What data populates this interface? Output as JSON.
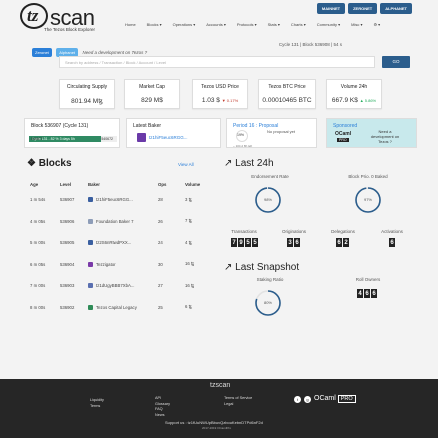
{
  "brand": {
    "logo_glyph": "tz",
    "name": "scan",
    "tagline": "The Tezos Block Explorer"
  },
  "top_buttons": [
    {
      "label": "MAINNET"
    },
    {
      "label": "ZERONET"
    },
    {
      "label": "ALPHANET"
    }
  ],
  "nav": [
    "Home",
    "Blocks ▾",
    "Operations ▾",
    "Accounts ▾",
    "Protocols ▾",
    "Stats ▾",
    "Charts ▾",
    "Community ▾",
    "Misc ▾",
    "⚙ ▾"
  ],
  "infobar": {
    "mainnet": "Zeronet",
    "alphanet": "Alphanet",
    "dev_text": "Need a development on Tezos ?",
    "cycle_text": "Cycle 131 | Block 536908 | 54 s"
  },
  "search": {
    "placeholder": "Search by address / Transaction / Block / Account / Level",
    "go": "GO"
  },
  "stats": [
    {
      "label": "Circulating Supply",
      "value": "801.94 M",
      "suffix": "ꜩ",
      "delta": ""
    },
    {
      "label": "Market Cap",
      "value": "829 M$",
      "suffix": "",
      "delta": ""
    },
    {
      "label": "Tezos USD Price",
      "value": "1.03 $",
      "suffix": "",
      "delta": "▼ 0.17%"
    },
    {
      "label": "Tezos BTC Price",
      "value": "0.00010465 BTC",
      "suffix": "",
      "delta": ""
    },
    {
      "label": "Volume 24h",
      "value": "667.9 K$",
      "suffix": "",
      "delta": "▲ 5.86%"
    }
  ],
  "cycle_card": {
    "title": "Block 536907 (Cycle 131)",
    "left": "536877",
    "progress_label": "Cycle 131 - 82 % 3 days 5h",
    "right": "540672",
    "progress": 0.82
  },
  "latest_baker": {
    "title": "Latest Baker",
    "name": "tz1hiF5euc6RGG..."
  },
  "period": {
    "title": "Period 16 : Proposal",
    "note": "No proposal yet",
    "pct": "19%",
    "remaining": "~ 104 d 8h left"
  },
  "sponsored": {
    "title": "Sponsored",
    "logo_text": "OCaml",
    "logo_badge": "PRO",
    "text": "Need a development on Tezos ?"
  },
  "blocks": {
    "title": "Blocks",
    "view_all": "View All",
    "columns": [
      "Age",
      "Level",
      "Baker",
      "Ops",
      "Volume"
    ],
    "rows": [
      {
        "age": "1 m 54s",
        "level": "536907",
        "baker": "tz1hiF5euc6RGG...",
        "ops": "28",
        "volume": "3 ꜩ",
        "color": "#3a5fa0"
      },
      {
        "age": "4 m 05s",
        "level": "536906",
        "baker": "Foundation Baker 7",
        "ops": "26",
        "volume": "7 ꜩ",
        "color": "#8e9db8"
      },
      {
        "age": "5 m 00s",
        "level": "536905",
        "baker": "tz2S6nRtwdPXX...",
        "ops": "24",
        "volume": "4 ꜩ",
        "color": "#3a5fa0"
      },
      {
        "age": "6 m 05s",
        "level": "536904",
        "baker": "Tezzigator",
        "ops": "30",
        "volume": "16 ꜩ",
        "color": "#7a3aa8"
      },
      {
        "age": "7 m 00s",
        "level": "536903",
        "baker": "tz1dUgyBBB7XbA...",
        "ops": "27",
        "volume": "16 ꜩ",
        "color": "#5a6fb0"
      },
      {
        "age": "8 m 00s",
        "level": "536902",
        "baker": "Tezos Capital Legacy",
        "ops": "25",
        "volume": "6 ꜩ",
        "color": "#2e8b57"
      }
    ]
  },
  "last24": {
    "title": "Last 24h",
    "endorsement_label": "Endorsement Rate",
    "endorsement_pct": "98%",
    "endorsement_val": 0.98,
    "blockprio_label": "Block Prio. 0 Baked",
    "blockprio_pct": "97%",
    "blockprio_val": 0.97,
    "counters": [
      {
        "label": "Transactions",
        "digits": [
          "7",
          "9",
          "5",
          "5"
        ]
      },
      {
        "label": "Originations",
        "digits": [
          "3",
          "6"
        ]
      },
      {
        "label": "Delegations",
        "digits": [
          "6",
          "2"
        ]
      },
      {
        "label": "Activations",
        "digits": [
          "6"
        ]
      }
    ]
  },
  "snapshot": {
    "title": "Last Snapshot",
    "staking_label": "Staking Ratio",
    "staking_pct": "80%",
    "staking_val": 0.8,
    "roll_label": "Roll Owners",
    "roll_digits": [
      "4",
      "6",
      "6"
    ]
  },
  "footer": {
    "logo": "tzscan",
    "col1": [
      "Liquidity",
      "Terms"
    ],
    "col2": [
      "API",
      "Glossary",
      "FAQ",
      "News"
    ],
    "col3": [
      "Terms of Service",
      "Legal"
    ],
    "support": "Support us : tz1fUuNWUpBbuvQzbouKebnDTPd6nF2d",
    "copyright": "2017-2019 OCamlPro",
    "ocaml": "OCaml",
    "pro": "PRO"
  },
  "colors": {
    "brand_blue": "#2b5d8c",
    "link": "#2b7fd8",
    "ring": "#2b5d8c",
    "footer_bg": "#262626",
    "sponsor_bg": "#c8e9ec"
  }
}
